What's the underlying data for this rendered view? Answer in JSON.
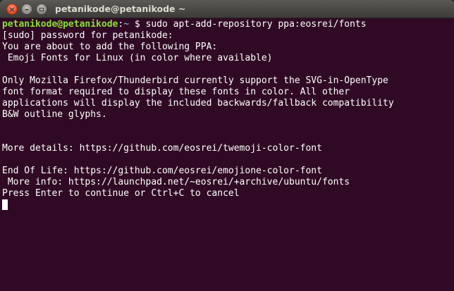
{
  "window": {
    "title": "petanikode@petanikode ~",
    "buttons": {
      "close_icon": "close-icon",
      "minimize_icon": "minimize-icon",
      "maximize_icon": "maximize-icon",
      "close_glyph": "×",
      "minimize_glyph": "–"
    }
  },
  "colors": {
    "terminal_background": "#300a24",
    "prompt_user": "#8ae234",
    "prompt_path": "#729fcf",
    "text": "#ffffff"
  },
  "terminal": {
    "prompt": {
      "user_host": "petanikode@petanikode",
      "separator": ":",
      "path": "~",
      "symbol": "$",
      "command": " sudo apt-add-repository ppa:eosrei/fonts"
    },
    "output": [
      "[sudo] password for petanikode:",
      "You are about to add the following PPA:",
      " Emoji Fonts for Linux (in color where available)",
      "",
      "Only Mozilla Firefox/Thunderbird currently support the SVG-in-OpenType",
      "font format required to display these fonts in color. All other",
      "applications will display the included backwards/fallback compatibility",
      "B&W outline glyphs.",
      "",
      "",
      "More details: https://github.com/eosrei/twemoji-color-font",
      "",
      "End Of Life: https://github.com/eosrei/emojione-color-font",
      " More info: https://launchpad.net/~eosrei/+archive/ubuntu/fonts",
      "Press Enter to continue or Ctrl+C to cancel"
    ]
  }
}
